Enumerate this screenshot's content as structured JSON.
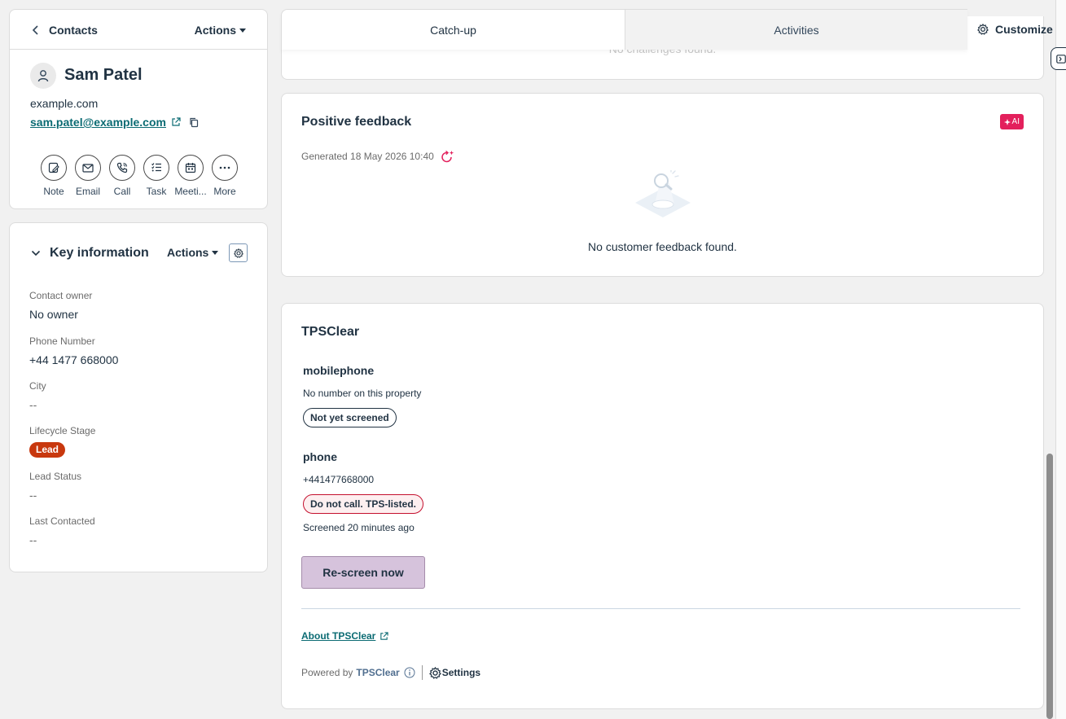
{
  "contact_header": {
    "back_label": "Contacts",
    "actions_label": "Actions",
    "name": "Sam Patel",
    "domain": "example.com",
    "email": "sam.patel@example.com",
    "actions": [
      {
        "label": "Note",
        "icon": "note-icon"
      },
      {
        "label": "Email",
        "icon": "email-icon"
      },
      {
        "label": "Call",
        "icon": "call-icon"
      },
      {
        "label": "Task",
        "icon": "task-icon"
      },
      {
        "label": "Meeti...",
        "icon": "meeting-icon"
      },
      {
        "label": "More",
        "icon": "more-icon"
      }
    ]
  },
  "key_info": {
    "title": "Key information",
    "actions_label": "Actions",
    "fields": [
      {
        "label": "Contact owner",
        "value": "No owner"
      },
      {
        "label": "Phone Number",
        "value": "+44 1477 668000"
      },
      {
        "label": "City",
        "value": "--"
      },
      {
        "label": "Lifecycle Stage",
        "value": "Lead"
      },
      {
        "label": "Lead Status",
        "value": "--"
      },
      {
        "label": "Last Contacted",
        "value": "--"
      }
    ]
  },
  "tabs": [
    {
      "label": "Catch-up",
      "active": true
    },
    {
      "label": "Activities",
      "active": false
    }
  ],
  "customize_label": "Customize",
  "challenges_card": {
    "empty_text": "No challenges found."
  },
  "feedback_card": {
    "title": "Positive feedback",
    "ai_badge": "AI",
    "generated_text": "Generated 18 May 2026 10:40",
    "empty_text": "No customer feedback found."
  },
  "tpsclear": {
    "title": "TPSClear",
    "mobile": {
      "heading": "mobilephone",
      "detail": "No number on this property",
      "badge": "Not yet screened"
    },
    "phone": {
      "heading": "phone",
      "number": "+441477668000",
      "badge": "Do not call. TPS-listed.",
      "screened": "Screened 20 minutes ago"
    },
    "rescreen_label": "Re-screen now",
    "about_link": "About TPSClear",
    "powered_prefix": "Powered by",
    "powered_brand": "TPSClear",
    "settings_label": "Settings"
  },
  "colors": {
    "accent_teal": "#0b6b73",
    "lifecycle_badge": "#c8380e",
    "ai_badge": "#e3205c",
    "dnc_border": "#c4102e",
    "rescreen_bg": "#d6c3dc"
  }
}
